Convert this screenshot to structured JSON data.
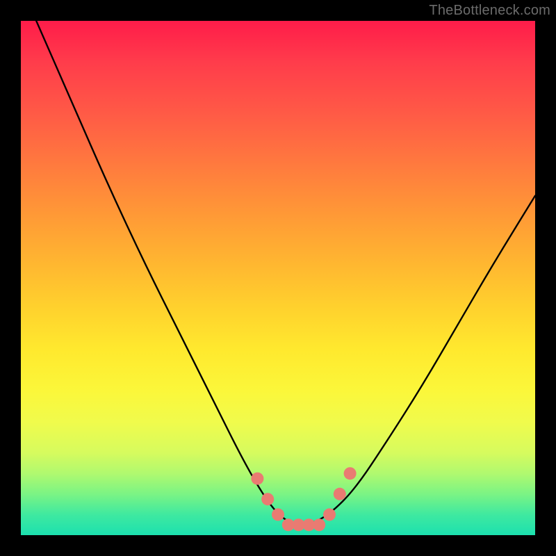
{
  "watermark": {
    "text": "TheBottleneck.com"
  },
  "chart_data": {
    "type": "line",
    "title": "",
    "xlabel": "",
    "ylabel": "",
    "xlim": [
      0,
      100
    ],
    "ylim": [
      0,
      100
    ],
    "series": [
      {
        "name": "bottleneck-curve",
        "x": [
          3,
          10,
          17,
          24,
          31,
          38,
          43,
          47,
          50,
          53,
          56,
          60,
          65,
          71,
          78,
          85,
          92,
          100
        ],
        "y": [
          100,
          84,
          68,
          53,
          39,
          25,
          15,
          8,
          4,
          2,
          2,
          4,
          9,
          18,
          29,
          41,
          53,
          66
        ]
      }
    ],
    "markers": [
      {
        "name": "left-marker-1",
        "x": 46,
        "y": 11
      },
      {
        "name": "left-marker-2",
        "x": 48,
        "y": 7
      },
      {
        "name": "left-marker-3",
        "x": 50,
        "y": 4
      },
      {
        "name": "floor-marker-1",
        "x": 52,
        "y": 2
      },
      {
        "name": "floor-marker-2",
        "x": 54,
        "y": 2
      },
      {
        "name": "floor-marker-3",
        "x": 56,
        "y": 2
      },
      {
        "name": "floor-marker-4",
        "x": 58,
        "y": 2
      },
      {
        "name": "right-marker-1",
        "x": 60,
        "y": 4
      },
      {
        "name": "right-marker-2",
        "x": 62,
        "y": 8
      },
      {
        "name": "right-marker-3",
        "x": 64,
        "y": 12
      }
    ],
    "background_gradient": {
      "top": "#ff1c4a",
      "mid": "#ffe92e",
      "bottom": "#1ce0af"
    }
  }
}
